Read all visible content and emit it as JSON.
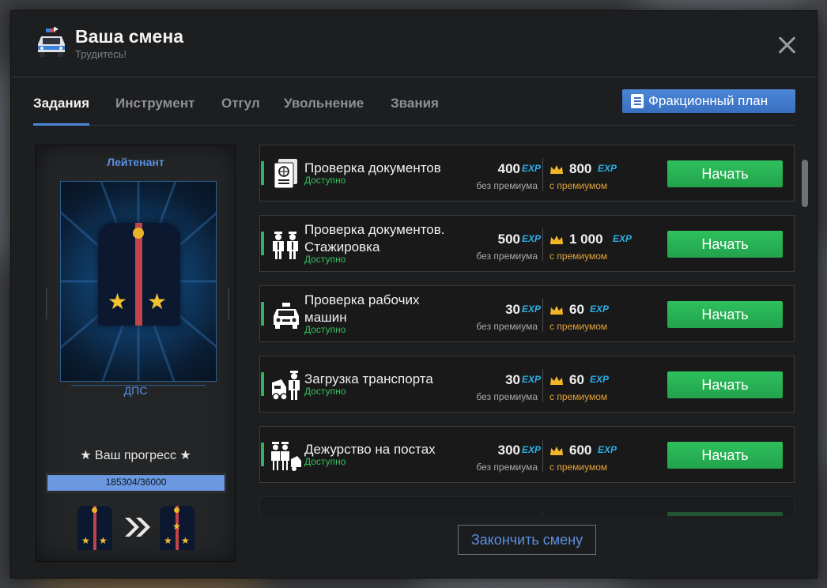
{
  "header": {
    "title": "Ваша смена",
    "subtitle": "Трудитесь!",
    "icon": "police-car-icon"
  },
  "tabs": [
    {
      "label": "Задания",
      "active": true
    },
    {
      "label": "Инструмент",
      "active": false
    },
    {
      "label": "Отгул",
      "active": false
    },
    {
      "label": "Увольнение",
      "active": false
    },
    {
      "label": "Звания",
      "active": false
    }
  ],
  "plan_button": {
    "label": "Фракционный план",
    "icon": "checklist-icon"
  },
  "rank": {
    "name": "Лейтенант",
    "unit": "ДПС",
    "progress_title": "★ Ваш прогресс ★",
    "progress_text": "185304/36000",
    "progress_fraction": 1.0
  },
  "tasks": [
    {
      "name": "Проверка документов",
      "status": "Доступно",
      "exp": "400",
      "exp_premium": "800",
      "icon": "passport-icon"
    },
    {
      "name": "Проверка документов. Стажировка",
      "status": "Доступно",
      "exp": "500",
      "exp_premium": "1 000",
      "icon": "officers-icon"
    },
    {
      "name": "Проверка рабочих машин",
      "status": "Доступно",
      "exp": "30",
      "exp_premium": "60",
      "icon": "police-car-icon"
    },
    {
      "name": "Загрузка транспорта",
      "status": "Доступно",
      "exp": "30",
      "exp_premium": "60",
      "icon": "tow-officer-icon"
    },
    {
      "name": "Дежурство на постах",
      "status": "Доступно",
      "exp": "300",
      "exp_premium": "600",
      "icon": "post-officers-icon"
    }
  ],
  "labels": {
    "exp": "EXP",
    "without_premium": "без премиума",
    "with_premium": "с премиумом",
    "start": "Начать",
    "finish_shift": "Закончить смену"
  },
  "colors": {
    "accent_blue": "#4c86d8",
    "start_green": "#2ec05d",
    "status_green": "#33c05c",
    "premium_orange": "#e3a338",
    "exp_cyan": "#2bb0e8"
  }
}
